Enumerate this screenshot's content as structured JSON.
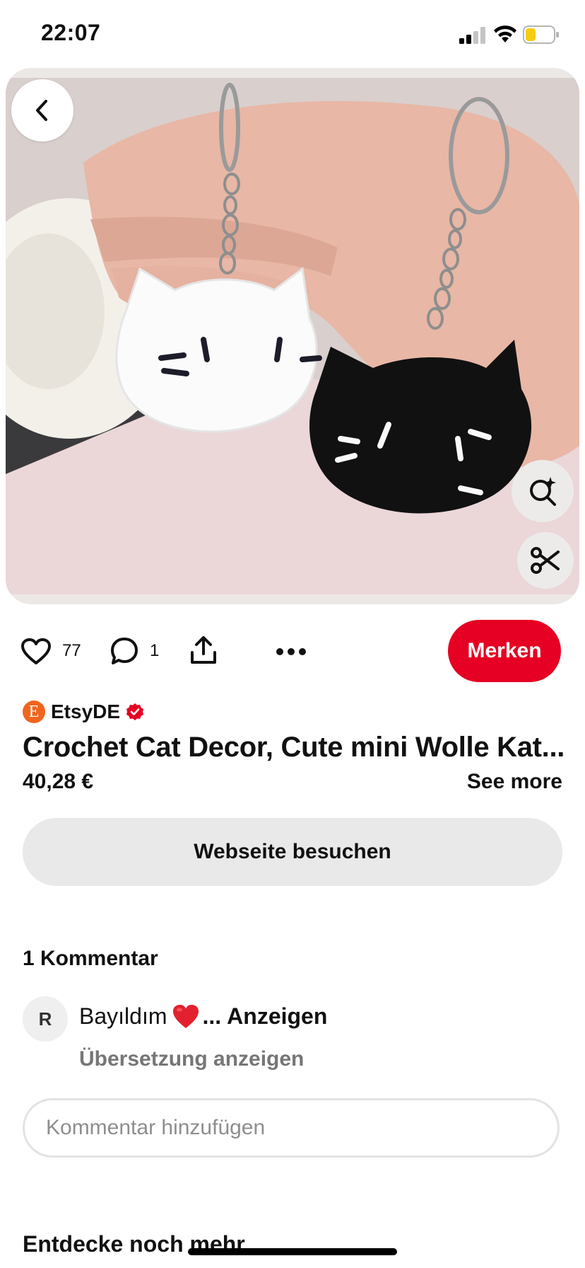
{
  "status_bar": {
    "time": "22:07"
  },
  "pin": {
    "image_description_icon": "crochet-cat-keychains-photo"
  },
  "actions": {
    "like_count": "77",
    "comment_count": "1",
    "save_label": "Merken"
  },
  "source": {
    "avatar_letter": "E",
    "name": "EtsyDE"
  },
  "product": {
    "title": "Crochet Cat Decor, Cute mini Wolle Kat...",
    "price": "40,28 €",
    "see_more": "See more",
    "visit_label": "Webseite besuchen"
  },
  "comments": {
    "heading": "1 Kommentar",
    "items": [
      {
        "avatar_letter": "R",
        "text": "Bayıldım",
        "ellipsis": "...",
        "show_label": "Anzeigen",
        "translate_label": "Übersetzung anzeigen"
      }
    ],
    "input_placeholder": "Kommentar hinzufügen"
  },
  "discover": {
    "heading": "Entdecke noch mehr"
  },
  "colors": {
    "save_red": "#e60023",
    "etsy_orange": "#f1641e",
    "verified_red": "#e60023",
    "battery_yellow": "#f5cc0f"
  }
}
